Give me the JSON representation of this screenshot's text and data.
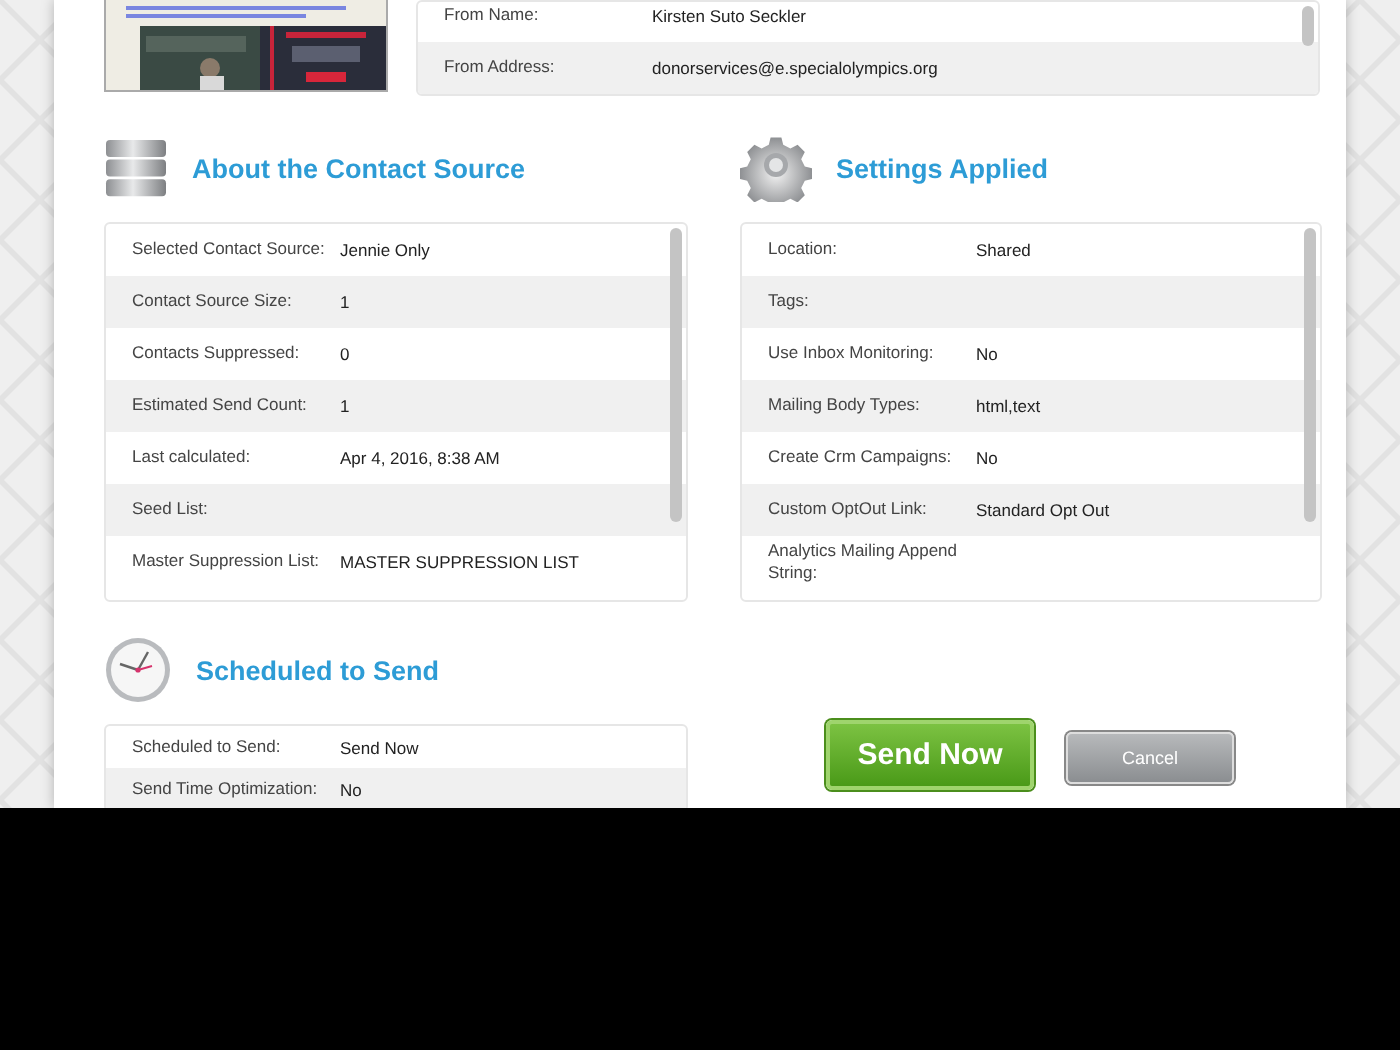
{
  "sender": [
    {
      "label": "From Name:",
      "value": "Kirsten Suto Seckler"
    },
    {
      "label": "From Address:",
      "value": "donorservices@e.specialolympics.org"
    }
  ],
  "sections": [
    {
      "title": "About the Contact Source",
      "rows": [
        {
          "label": "Selected Contact Source:",
          "value": "Jennie Only"
        },
        {
          "label": "Contact Source Size:",
          "value": "1"
        },
        {
          "label": "Contacts Suppressed:",
          "value": "0"
        },
        {
          "label": "Estimated Send Count:",
          "value": "1"
        },
        {
          "label": "Last calculated:",
          "value": "Apr 4, 2016, 8:38 AM"
        },
        {
          "label": "Seed List:"
        },
        {
          "label": "Master Suppression List:",
          "value": "MASTER SUPPRESSION LIST"
        }
      ]
    },
    {
      "title": "Settings Applied",
      "rows": [
        {
          "label": "Location:",
          "value": "Shared"
        },
        {
          "label": "Tags:"
        },
        {
          "label": "Use Inbox Monitoring:",
          "value": "No"
        },
        {
          "label": "Mailing Body Types:",
          "value": "html,text"
        },
        {
          "label": "Create Crm Campaigns:",
          "value": "No"
        },
        {
          "label": "Custom OptOut Link:",
          "value": "Standard Opt Out"
        },
        {
          "label": "Analytics Mailing Append String:"
        }
      ]
    },
    {
      "title": "Scheduled to Send",
      "rows": [
        {
          "label": "Scheduled to Send:",
          "value": "Send Now"
        },
        {
          "label": "Send Time Optimization:",
          "value": "No"
        }
      ]
    }
  ],
  "buttons": [
    {
      "label": "Send Now",
      "kind": "primary"
    },
    {
      "label": "Cancel",
      "kind": "secondary"
    }
  ]
}
